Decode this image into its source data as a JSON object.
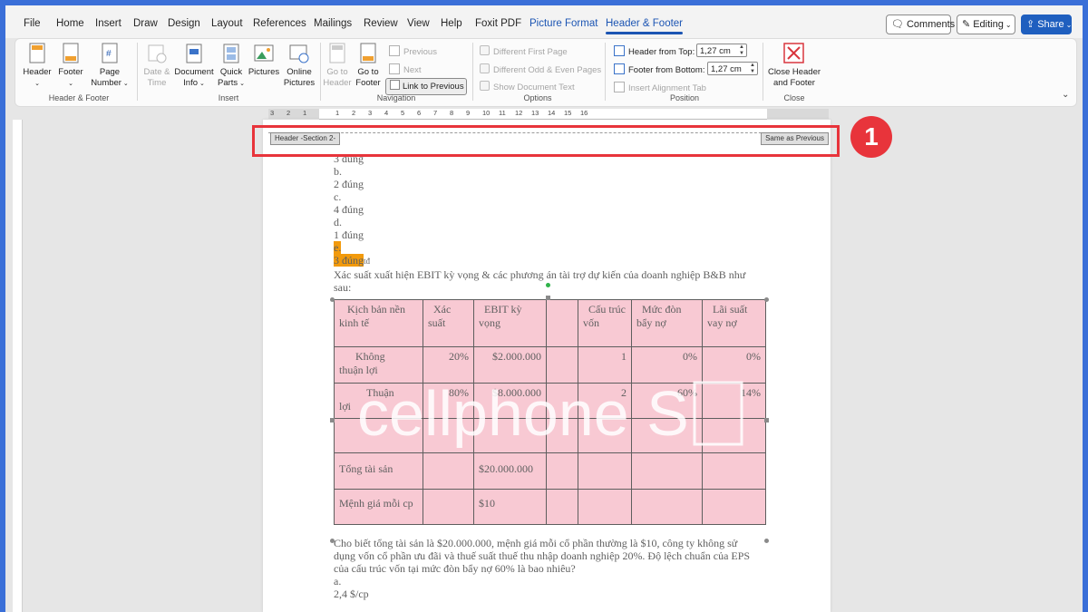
{
  "menu": {
    "tabs": [
      "File",
      "Home",
      "Insert",
      "Draw",
      "Design",
      "Layout",
      "References",
      "Mailings",
      "Review",
      "View",
      "Help",
      "Foxit PDF",
      "Picture Format",
      "Header & Footer"
    ],
    "active_tab": "Header & Footer",
    "comments": "Comments",
    "editing": "Editing",
    "share": "Share"
  },
  "ribbon": {
    "header_footer": {
      "header": "Header",
      "footer": "Footer",
      "page": "Page",
      "number": "Number",
      "label": "Header & Footer"
    },
    "insert": {
      "date_l1": "Date &",
      "date_l2": "Time",
      "doc_l1": "Document",
      "doc_l2": "Info",
      "quick_l1": "Quick",
      "quick_l2": "Parts",
      "pictures": "Pictures",
      "online_l1": "Online",
      "online_l2": "Pictures",
      "label": "Insert"
    },
    "navigation": {
      "goto_header_l1": "Go to",
      "goto_header_l2": "Header",
      "goto_footer_l1": "Go to",
      "goto_footer_l2": "Footer",
      "previous": "Previous",
      "next": "Next",
      "link_to_previous": "Link to Previous",
      "label": "Navigation"
    },
    "options": {
      "diff_first": "Different First Page",
      "diff_odd_even": "Different Odd & Even Pages",
      "show_doc_text": "Show Document Text",
      "label": "Options"
    },
    "position": {
      "header_from_top": "Header from Top:",
      "header_value": "1,27 cm",
      "footer_from_bottom": "Footer from Bottom:",
      "footer_value": "1,27 cm",
      "insert_alignment_tab": "Insert Alignment Tab",
      "label": "Position"
    },
    "close": {
      "l1": "Close Header",
      "l2": "and Footer",
      "label": "Close"
    }
  },
  "ruler": [
    "3",
    "2",
    "1",
    "1",
    "2",
    "3",
    "4",
    "5",
    "6",
    "7",
    "8",
    "9",
    "10",
    "11",
    "12",
    "13",
    "14",
    "15",
    "16"
  ],
  "document": {
    "header_tag": "Header -Section 2-",
    "same_as_previous": "Same as Previous",
    "callout_number": "1",
    "lines_top": [
      "3 đúng",
      "b.",
      "2 đúng",
      "c.",
      "4 đúng",
      "d.",
      "1 đúng"
    ],
    "hl_e": "e.",
    "hl_text": "3 đúng",
    "after_hl": "tđ",
    "intro_l1": "Xác suất xuất hiện EBIT kỳ vọng & các phương án tài trợ dự kiến của doanh nghiệp B&B như",
    "intro_l2": "sau:",
    "table": {
      "h1": [
        "Kịch bản nền",
        "kinh tế"
      ],
      "h2": [
        "Xác",
        "suất"
      ],
      "h3": [
        "EBIT kỳ",
        "vọng"
      ],
      "h4": "",
      "h5": [
        "Cấu trúc",
        "vốn"
      ],
      "h6": [
        "Mức đòn",
        "bẩy nợ"
      ],
      "h7": [
        "Lãi suất",
        "vay nợ"
      ],
      "r1": [
        "Không",
        "thuận lợi",
        "20%",
        "$2.000.000",
        "1",
        "0%",
        "0%"
      ],
      "r2": [
        "Thuận",
        "lợi",
        "80%",
        "$8.000.000",
        "2",
        "60%",
        "14%"
      ],
      "total_assets": "Tổng tài sản",
      "total_assets_val": "$20.000.000",
      "par_value": "Mệnh giá mỗi cp",
      "par_value_val": "$10"
    },
    "after_l1": "Cho biết tổng tài sản là $20.000.000, mệnh giá mỗi cổ phần thường là $10, công ty không sử",
    "after_l2": "dụng vốn cổ phần ưu đãi và thuế suất thuế thu nhập doanh nghiệp 20%. Độ lệch chuẩn của EPS",
    "after_l3": "của cấu trúc vốn tại mức đòn bẩy nợ 60% là bao nhiêu?",
    "after_l4": "a.",
    "after_l5": "2,4 $/cp",
    "watermark": "cellphone S"
  }
}
